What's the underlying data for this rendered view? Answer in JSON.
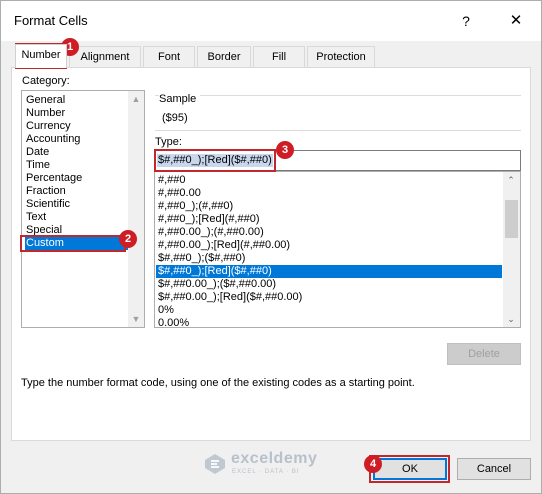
{
  "window": {
    "title": "Format Cells",
    "help_glyph": "?",
    "close_glyph": "✕"
  },
  "tabs": [
    {
      "label": "Number"
    },
    {
      "label": "Alignment"
    },
    {
      "label": "Font"
    },
    {
      "label": "Border"
    },
    {
      "label": "Fill"
    },
    {
      "label": "Protection"
    }
  ],
  "category": {
    "label": "Category:",
    "items": [
      "General",
      "Number",
      "Currency",
      "Accounting",
      "Date",
      "Time",
      "Percentage",
      "Fraction",
      "Scientific",
      "Text",
      "Special",
      "Custom"
    ],
    "selected": "Custom"
  },
  "sample": {
    "label": "Sample",
    "value": "($95)"
  },
  "type": {
    "label": "Type:",
    "value": "$#,##0_);[Red]($#,##0)",
    "options": [
      "#,##0",
      "#,##0.00",
      "#,##0_);(#,##0)",
      "#,##0_);[Red](#,##0)",
      "#,##0.00_);(#,##0.00)",
      "#,##0.00_);[Red](#,##0.00)",
      "$#,##0_);($#,##0)",
      "$#,##0_);[Red]($#,##0)",
      "$#,##0.00_);($#,##0.00)",
      "$#,##0.00_);[Red]($#,##0.00)",
      "0%",
      "0.00%"
    ],
    "selected_index": 7
  },
  "buttons": {
    "delete": "Delete",
    "ok": "OK",
    "cancel": "Cancel"
  },
  "description": "Type the number format code, using one of the existing codes as a starting point.",
  "watermark": {
    "name": "exceldemy",
    "tagline": "EXCEL · DATA · BI"
  },
  "callouts": [
    "1",
    "2",
    "3",
    "4"
  ],
  "colors": {
    "selection": "#0078d7",
    "callout": "#cf1d25",
    "highlight_border": "#c0282e"
  }
}
